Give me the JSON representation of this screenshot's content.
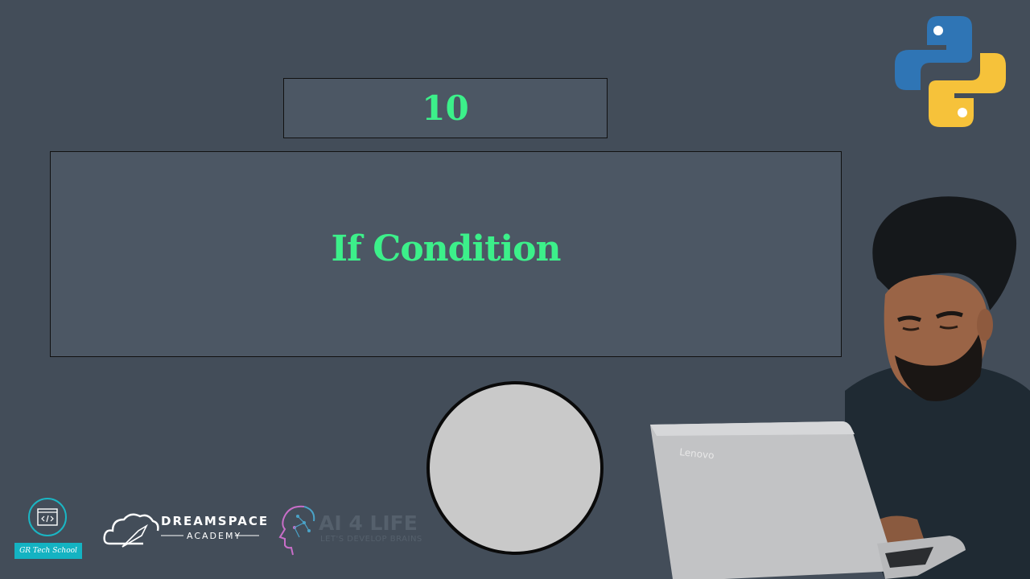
{
  "lesson": {
    "number": "10",
    "title": "If Condition"
  },
  "logos": {
    "python": {
      "icon": "python-logo-icon",
      "colors": {
        "blue": "#2f75b5",
        "yellow": "#f6c23a"
      }
    },
    "gr_tech_school": {
      "label": "GR Tech School",
      "icon": "code-window-icon",
      "color": "#14b3c2"
    },
    "dreamspace": {
      "name": "DREAMSPACE",
      "sub": "ACADEMY"
    },
    "ai4life": {
      "name": "AI 4 LIFE",
      "sub": "LET'S DEVELOP BRAINS",
      "icon_color": "#c86ec8"
    },
    "laptop_brand": "Lenovo"
  },
  "colors": {
    "background": "#434d59",
    "panel": "#4c5764",
    "accent": "#3cf08a"
  }
}
